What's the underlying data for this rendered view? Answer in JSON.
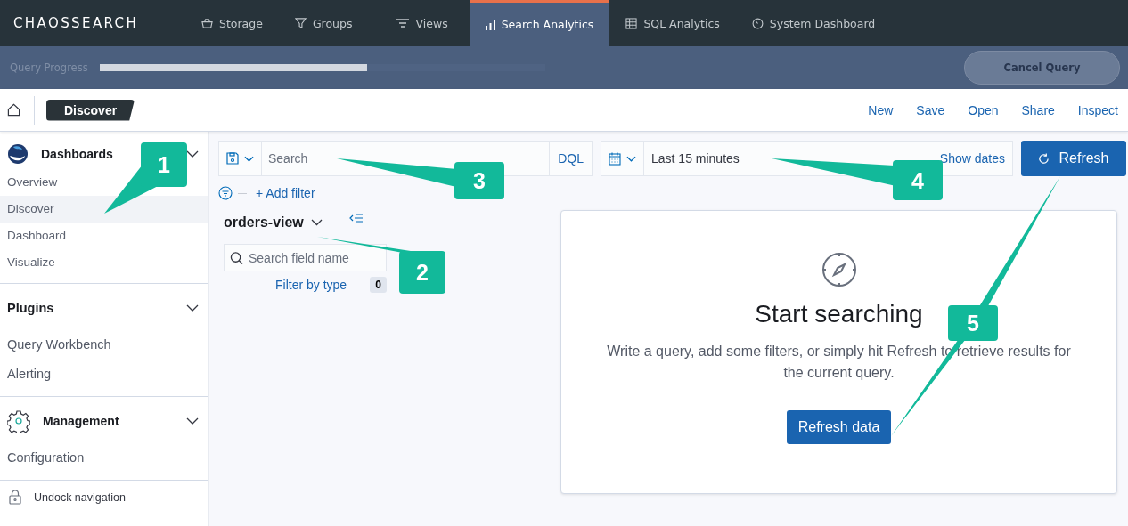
{
  "topnav": {
    "logo": "CHAOSSEARCH",
    "tabs": [
      {
        "label": "Storage",
        "selected": false
      },
      {
        "label": "Groups",
        "selected": false
      },
      {
        "label": "Views",
        "selected": false
      },
      {
        "label": "Search Analytics",
        "selected": true
      },
      {
        "label": "SQL Analytics",
        "selected": false
      },
      {
        "label": "System Dashboard",
        "selected": false
      }
    ]
  },
  "progress": {
    "label": "Query Progress",
    "level": 0.6,
    "cancel_button": "Cancel Query",
    "cancel_disabled": true
  },
  "header": {
    "breadcrumb": "Discover",
    "actions": [
      "New",
      "Save",
      "Open",
      "Share",
      "Inspect"
    ]
  },
  "sidebar": {
    "sections": [
      {
        "title": "Dashboards",
        "items": [
          {
            "label": "Overview",
            "selected": false
          },
          {
            "label": "Discover",
            "selected": true
          },
          {
            "label": "Dashboard",
            "selected": false
          },
          {
            "label": "Visualize",
            "selected": false
          }
        ]
      },
      {
        "title": "Plugins",
        "items": [
          {
            "label": "Query Workbench",
            "selected": false
          },
          {
            "label": "Alerting",
            "selected": false
          }
        ]
      },
      {
        "title": "Management",
        "items": [
          {
            "label": "Configuration",
            "selected": false
          }
        ]
      }
    ],
    "footer": "Undock navigation"
  },
  "query": {
    "search_placeholder": "Search",
    "language": "DQL",
    "time_range": "Last 15 minutes",
    "show_dates": "Show dates",
    "refresh_button": "Refresh",
    "add_filter": "+ Add filter"
  },
  "fields": {
    "index": "orders-view",
    "search_placeholder": "Search field name",
    "filter_by_type": "Filter by type",
    "filter_count": "0"
  },
  "empty_state": {
    "title": "Start searching",
    "text": "Write a query, add some filters, or simply hit Refresh to retrieve results for the current query.",
    "button": "Refresh data"
  },
  "callouts": [
    {
      "number": "1"
    },
    {
      "number": "2"
    },
    {
      "number": "3"
    },
    {
      "number": "4"
    },
    {
      "number": "5"
    }
  ]
}
